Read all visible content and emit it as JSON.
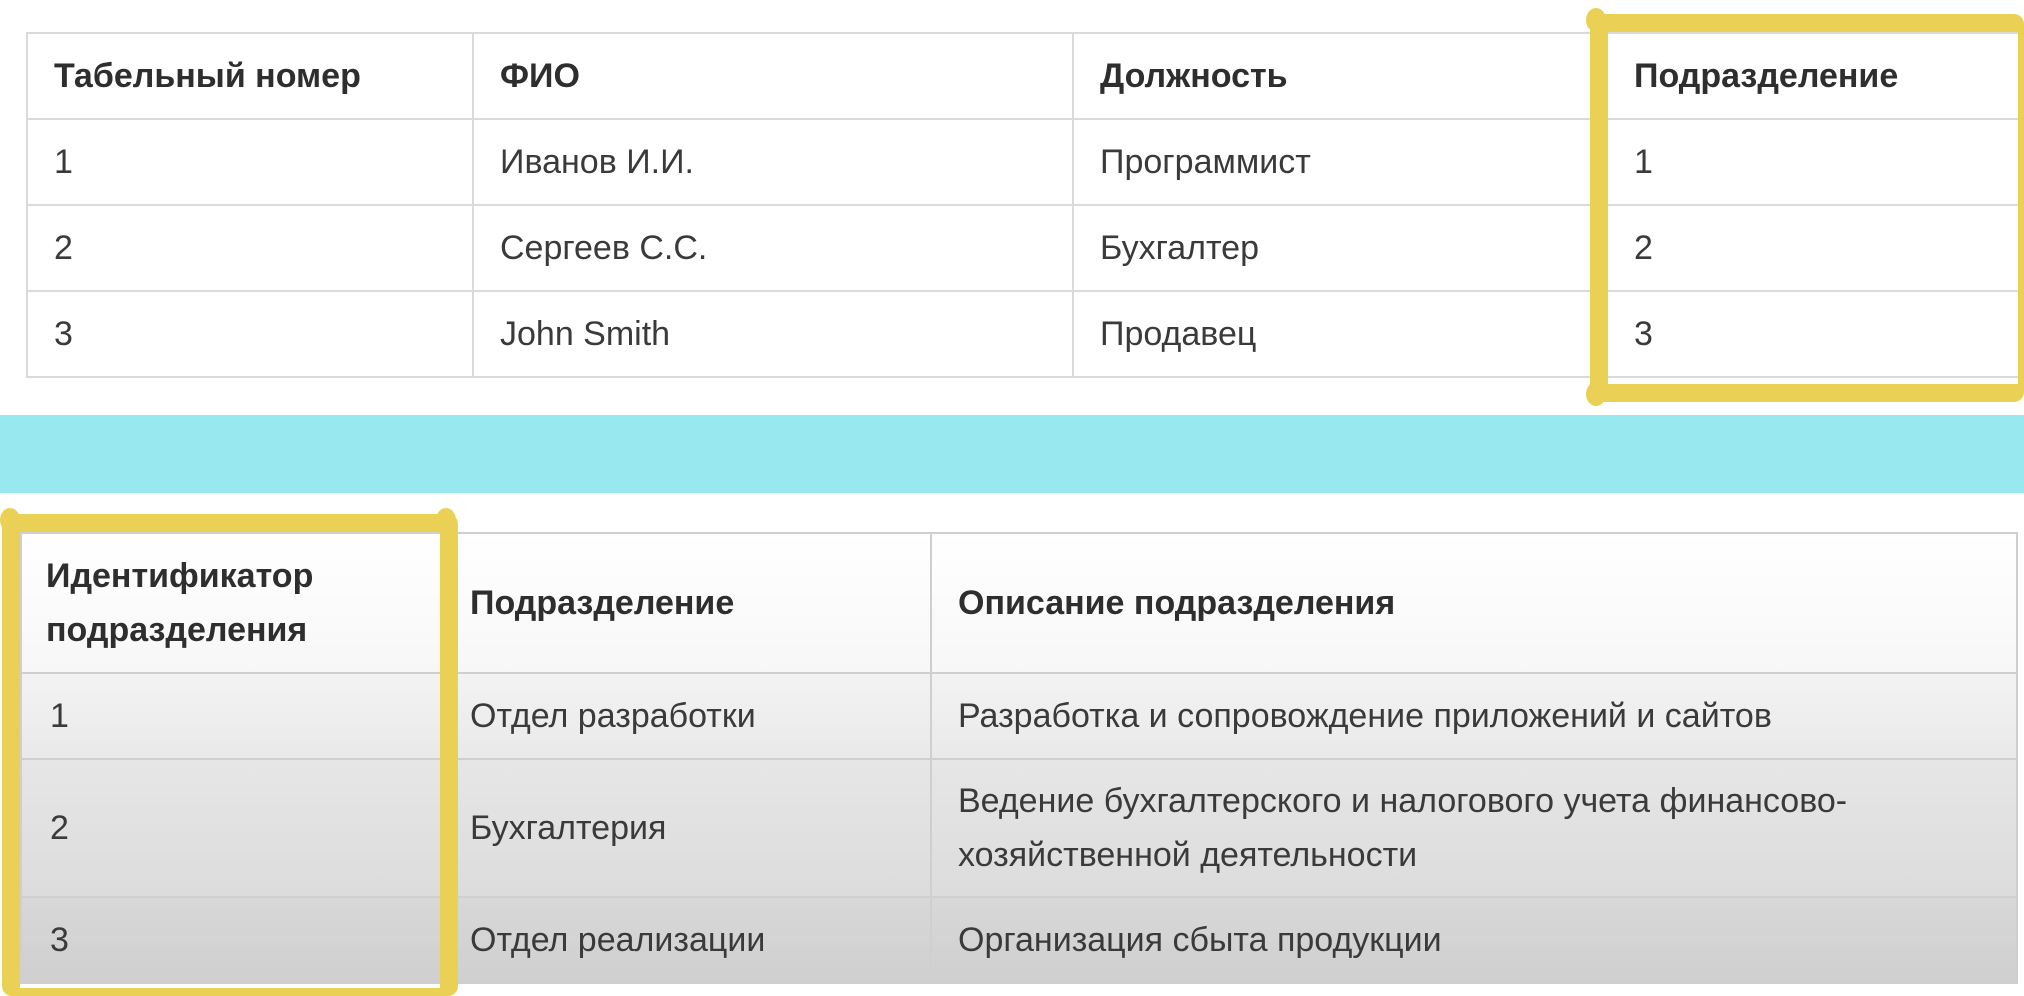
{
  "employees_table": {
    "headers": [
      "Табельный номер",
      "ФИО",
      "Должность",
      "Подразделение"
    ],
    "rows": [
      [
        "1",
        "Иванов И.И.",
        "Программист",
        "1"
      ],
      [
        "2",
        "Сергеев С.С.",
        "Бухгалтер",
        "2"
      ],
      [
        "3",
        "John Smith",
        "Продавец",
        "3"
      ]
    ]
  },
  "departments_table": {
    "headers": [
      "Идентификатор подразделения",
      "Подразделение",
      "Описание подразделения"
    ],
    "rows": [
      [
        "1",
        "Отдел разработки",
        "Разработка и сопровождение приложений и сайтов"
      ],
      [
        "2",
        "Бухгалтерия",
        "Ведение бухгалтерского и налогового учета финансово-хозяйственной деятельности"
      ],
      [
        "3",
        "Отдел реализации",
        "Организация сбыта продукции"
      ]
    ]
  },
  "colors": {
    "highlight": "#ead055",
    "separator_band": "#98e9ef",
    "table_border": "#dadada"
  }
}
